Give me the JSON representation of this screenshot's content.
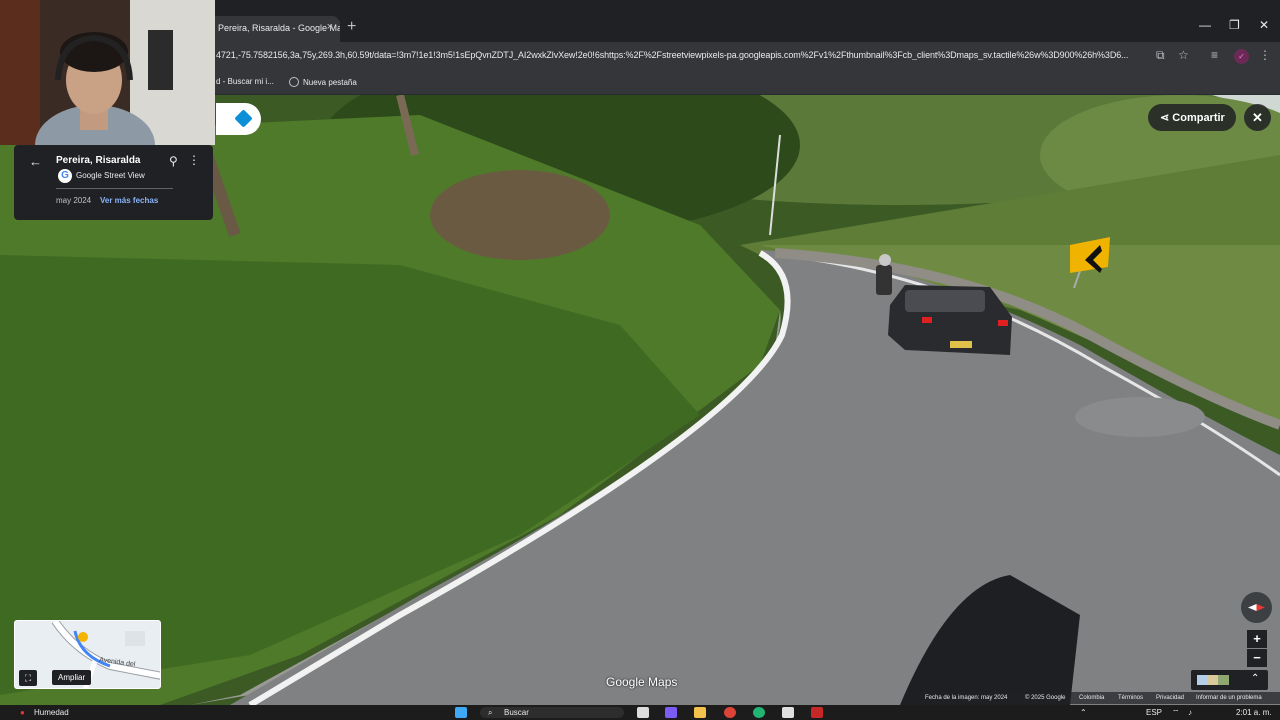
{
  "browser": {
    "tab_title": "Pereira, Risaralda - Google Maps",
    "tab_close": "×",
    "new_tab": "+",
    "url": "4721,-75.7582156,3a,75y,269.3h,60.59t/data=!3m7!1e1!3m5!1sEpQvnZDTJ_AI2wxkZlvXew!2e0!6shttps:%2F%2Fstreetviewpixels-pa.googleapis.com%2Fv1%2Fthumbnail%3Fcb_client%3Dmaps_sv.tactile%26w%3D900%26h%3D6...",
    "window_controls": [
      "—",
      "❐",
      "✕"
    ],
    "bookmarks": [
      "d - Buscar mi i...",
      "Nueva pestaña"
    ]
  },
  "street_view": {
    "share_label": "Compartir",
    "close_label": "✕",
    "location_title": "Pereira, Risaralda",
    "source": "Google Street View",
    "capture_date": "may 2024",
    "more_dates": "Ver más fechas",
    "minimap_street": "Avenida del",
    "expand_label": "Ampliar",
    "zoom_in": "+",
    "zoom_out": "−",
    "logo": "Google Maps",
    "footer": {
      "image_date": "Fecha de la imagen: may 2024",
      "copyright": "© 2025 Google",
      "country": "Colombia",
      "terms": "Términos",
      "privacy": "Privacidad",
      "report": "Informar de un problema"
    }
  },
  "taskbar": {
    "weather": "Humedad",
    "search_placeholder": "Buscar",
    "language": "ESP",
    "time": "2:01 a. m."
  },
  "colors": {
    "chrome_dark": "#202124",
    "chrome_mid": "#35363a",
    "link_blue": "#8ab4f8",
    "grass": "#4f7a2a",
    "road": "#7f8183"
  }
}
